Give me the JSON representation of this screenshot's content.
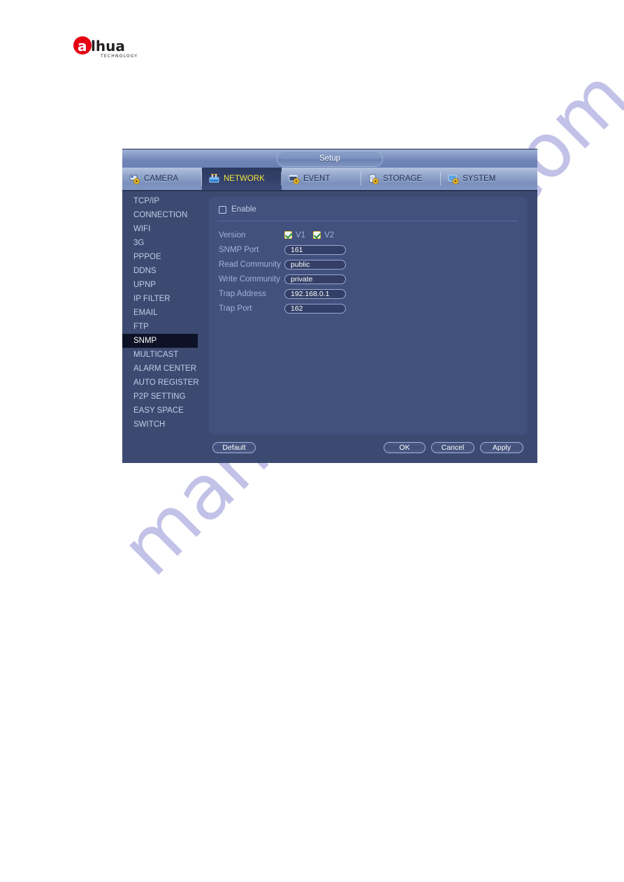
{
  "brand": {
    "logo_name": "dahua-logo",
    "logo_text": "alhua",
    "logo_subtext": "TECHNOLOGY",
    "logo_color": "#e60012"
  },
  "watermark": {
    "text": "manualshive.com"
  },
  "dialog": {
    "title": "Setup",
    "tabs": [
      {
        "label": "CAMERA",
        "icon": "camera-gear-icon",
        "active": false
      },
      {
        "label": "NETWORK",
        "icon": "network-cube-icon",
        "active": true
      },
      {
        "label": "EVENT",
        "icon": "event-gear-icon",
        "active": false
      },
      {
        "label": "STORAGE",
        "icon": "storage-gear-icon",
        "active": false
      },
      {
        "label": "SYSTEM",
        "icon": "system-gear-icon",
        "active": false
      }
    ],
    "sidebar": {
      "items": [
        {
          "label": "TCP/IP",
          "selected": false
        },
        {
          "label": "CONNECTION",
          "selected": false
        },
        {
          "label": "WIFI",
          "selected": false
        },
        {
          "label": "3G",
          "selected": false
        },
        {
          "label": "PPPOE",
          "selected": false
        },
        {
          "label": "DDNS",
          "selected": false
        },
        {
          "label": "UPNP",
          "selected": false
        },
        {
          "label": "IP FILTER",
          "selected": false
        },
        {
          "label": "EMAIL",
          "selected": false
        },
        {
          "label": "FTP",
          "selected": false
        },
        {
          "label": "SNMP",
          "selected": true
        },
        {
          "label": "MULTICAST",
          "selected": false
        },
        {
          "label": "ALARM CENTER",
          "selected": false
        },
        {
          "label": "AUTO REGISTER",
          "selected": false
        },
        {
          "label": "P2P SETTING",
          "selected": false
        },
        {
          "label": "EASY SPACE",
          "selected": false
        },
        {
          "label": "SWITCH",
          "selected": false
        }
      ]
    },
    "form": {
      "enable": {
        "label": "Enable",
        "checked": false
      },
      "version": {
        "label": "Version",
        "options": [
          {
            "label": "V1",
            "checked": true
          },
          {
            "label": "V2",
            "checked": true
          }
        ]
      },
      "fields": [
        {
          "label": "SNMP Port",
          "value": "161"
        },
        {
          "label": "Read Community",
          "value": "public"
        },
        {
          "label": "Write Community",
          "value": "private"
        },
        {
          "label": "Trap Address",
          "value": "192.168.0.1"
        },
        {
          "label": "Trap Port",
          "value": "162"
        }
      ]
    },
    "buttons": {
      "default": "Default",
      "ok": "OK",
      "cancel": "Cancel",
      "apply": "Apply"
    }
  },
  "colors": {
    "dialog_bg": "#3c4a72",
    "panel_bg": "#41507d",
    "selected_item_bg": "#0d1226",
    "active_tab_text": "#f2e23a",
    "label_text": "#9fb1dd",
    "checkbox_checked_border": "#e8c63a",
    "checkmark": "#1f8a3a"
  }
}
